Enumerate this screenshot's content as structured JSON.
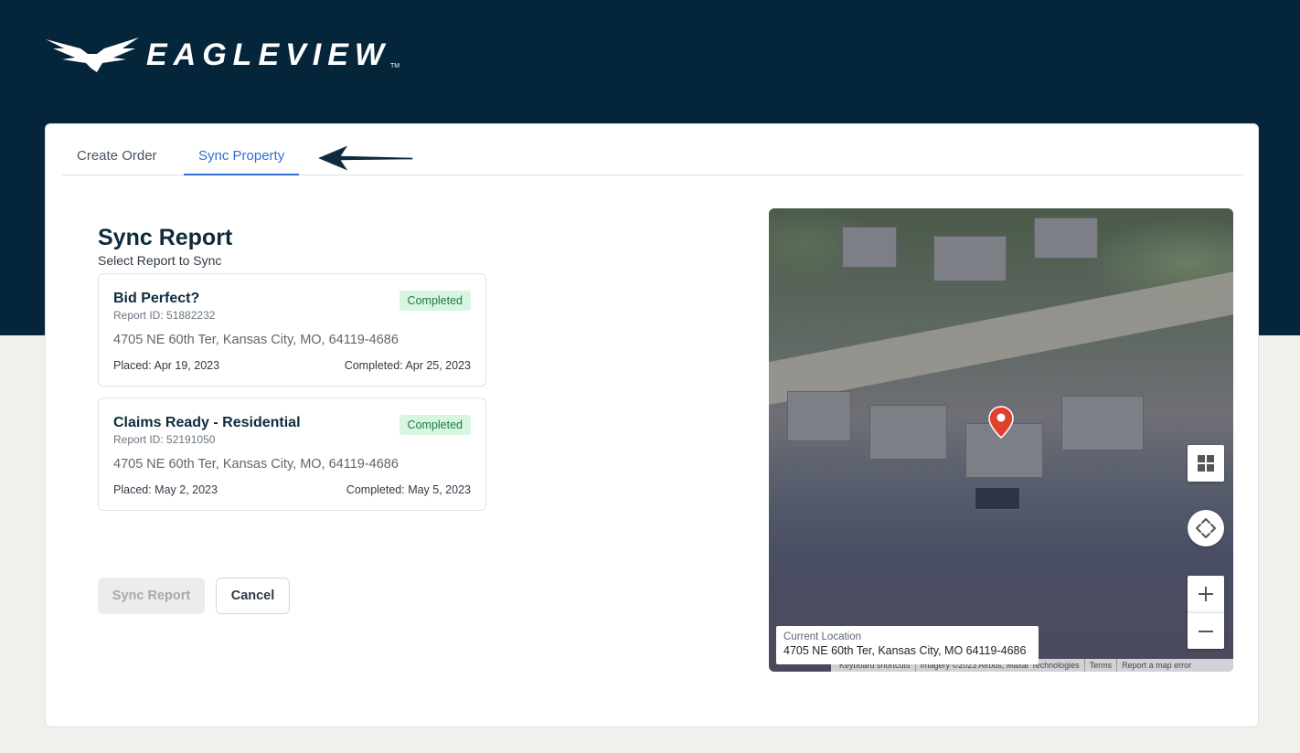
{
  "brand": {
    "name": "EAGLEVIEW",
    "tm": "TM"
  },
  "tabs": [
    {
      "label": "Create Order",
      "active": false
    },
    {
      "label": "Sync Property",
      "active": true
    }
  ],
  "section": {
    "title": "Sync Report",
    "subtitle": "Select Report to Sync"
  },
  "reports": [
    {
      "name": "Bid Perfect?",
      "report_id": "Report ID: 51882232",
      "status": "Completed",
      "address": "4705 NE 60th Ter, Kansas City, MO, 64119-4686",
      "placed": "Placed: Apr 19, 2023",
      "completed": "Completed: Apr 25, 2023"
    },
    {
      "name": "Claims Ready - Residential",
      "report_id": "Report ID: 52191050",
      "status": "Completed",
      "address": "4705 NE 60th Ter, Kansas City, MO, 64119-4686",
      "placed": "Placed: May 2, 2023",
      "completed": "Completed: May 5, 2023"
    }
  ],
  "buttons": {
    "sync": "Sync Report",
    "cancel": "Cancel"
  },
  "map": {
    "location_label": "Current Location",
    "location_address": "4705 NE 60th Ter, Kansas City, MO 64119-4686",
    "attribution": [
      "Keyboard shortcuts",
      "Imagery ©2023 Airbus, Maxar Technologies",
      "Terms",
      "Report a map error"
    ],
    "controls": {
      "layers": "grid-icon",
      "move": "move-arrows-icon",
      "zoom_in": "plus-icon",
      "zoom_out": "minus-icon"
    }
  },
  "colors": {
    "header_bg": "#05253a",
    "page_bg": "#f1f0ec",
    "active_tab": "#2f6fd6",
    "badge_bg": "#d8f5e2",
    "badge_text": "#1f7a43",
    "pin": "#e2402f"
  }
}
